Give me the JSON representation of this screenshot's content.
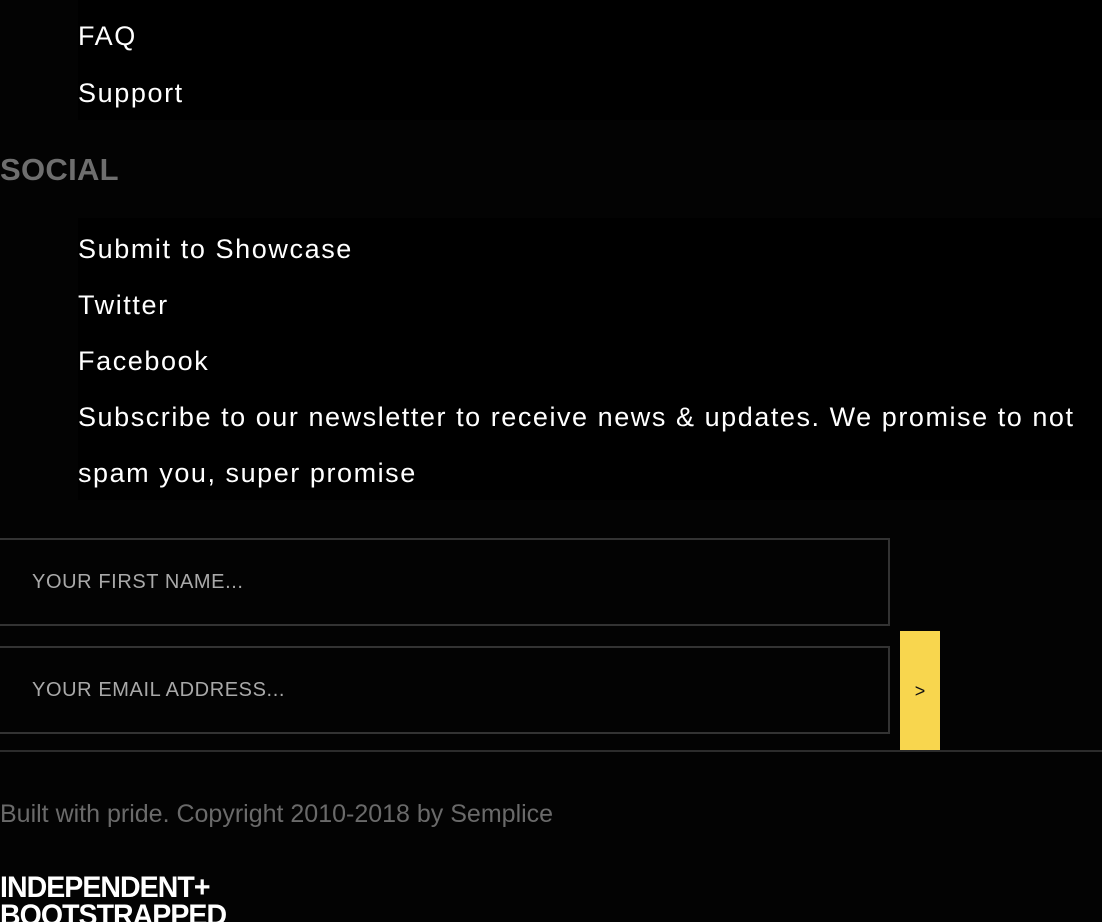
{
  "resources_links": [
    {
      "label": "FAQ"
    },
    {
      "label": "Support"
    }
  ],
  "social": {
    "heading": "SOCIAL",
    "links": [
      {
        "label": "Submit to Showcase"
      },
      {
        "label": "Twitter"
      },
      {
        "label": "Facebook"
      }
    ]
  },
  "newsletter": {
    "text": "Subscribe to our newsletter to receive news & updates. We promise to not spam you, super promise",
    "first_name_placeholder": "YOUR FIRST NAME...",
    "email_placeholder": "YOUR EMAIL ADDRESS...",
    "submit_label": ">"
  },
  "footer": {
    "copyright": "Built with pride. Copyright 2010-2018 by Semplice",
    "badge_line1": "INDEPENDENT+",
    "badge_line2": "BOOTSTRAPPED"
  },
  "colors": {
    "background": "#030303",
    "accent": "#f8d64e",
    "heading": "#6e6e6e",
    "muted_text": "#6a6a6a"
  }
}
